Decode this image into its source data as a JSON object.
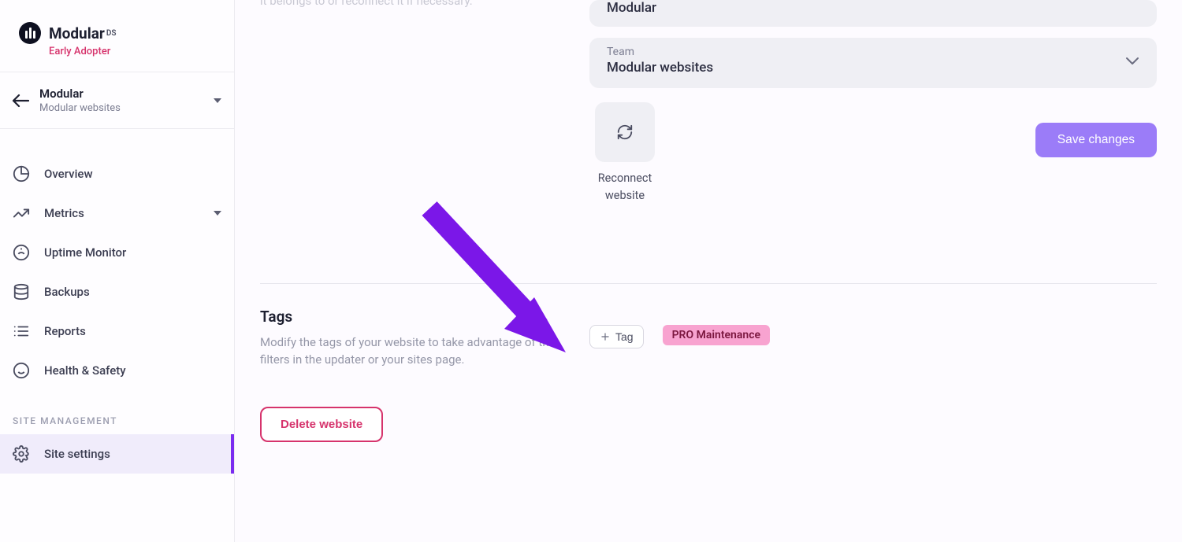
{
  "logo": {
    "text": "Modular",
    "suffix": "DS",
    "tagline": "Early Adopter"
  },
  "site_selector": {
    "name": "Modular",
    "subtitle": "Modular websites"
  },
  "nav": {
    "items": [
      {
        "label": "Overview"
      },
      {
        "label": "Metrics"
      },
      {
        "label": "Uptime Monitor"
      },
      {
        "label": "Backups"
      },
      {
        "label": "Reports"
      },
      {
        "label": "Health & Safety"
      }
    ],
    "section_label": "SITE MANAGEMENT",
    "site_settings": "Site settings"
  },
  "partial_desc": "it belongs to or reconnect it if necessary.",
  "client_field": {
    "value": "Modular"
  },
  "team_field": {
    "label": "Team",
    "value": "Modular websites"
  },
  "reconnect": "Reconnect website",
  "save_btn": "Save changes",
  "tags_section": {
    "title": "Tags",
    "description": "Modify the tags of your website to take advantage of the filters in the updater or your sites page.",
    "add_label": "Tag",
    "tag_chip": "PRO Maintenance"
  },
  "delete_btn": "Delete website"
}
